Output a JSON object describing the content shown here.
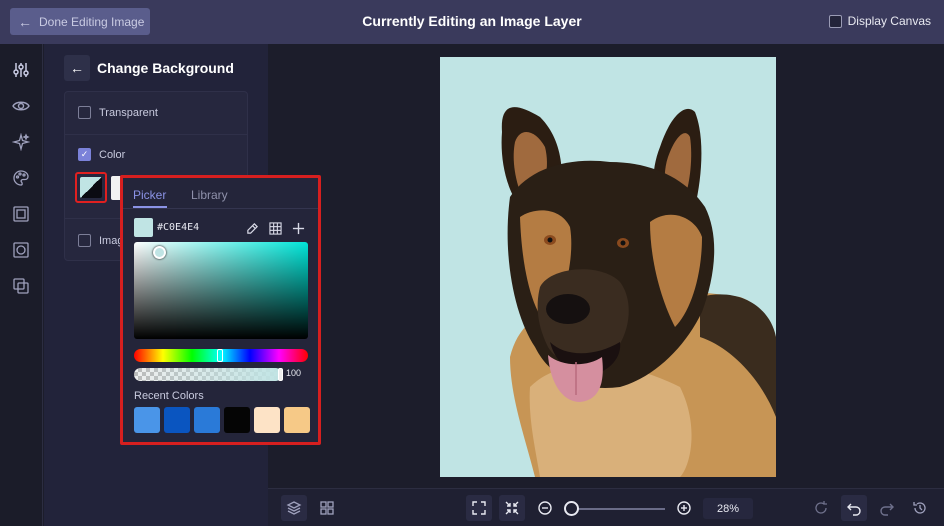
{
  "topbar": {
    "done_label": "Done Editing Image",
    "title": "Currently Editing an Image Layer",
    "display_canvas_label": "Display Canvas",
    "display_canvas_checked": false
  },
  "rail": {
    "icons": [
      "adjust-sliders-icon",
      "eye-icon",
      "sparkles-icon",
      "palette-icon",
      "frame-icon",
      "crop-frame-icon",
      "layers-blend-icon"
    ]
  },
  "panel": {
    "title": "Change Background",
    "options": [
      {
        "label": "Transparent",
        "checked": false
      },
      {
        "label": "Color",
        "checked": true
      },
      {
        "label": "Imag",
        "checked": false
      }
    ],
    "selected_swatch_color": "#C0E4E4"
  },
  "picker": {
    "tabs": [
      "Picker",
      "Library"
    ],
    "active_tab": "Picker",
    "hex_value": "#C0E4E4",
    "alpha_value": "100",
    "recent_label": "Recent Colors",
    "recent_colors": [
      "#4a95e8",
      "#0a55c0",
      "#2a7ad8",
      "#050505",
      "#fde3c6",
      "#f6c987"
    ]
  },
  "canvas": {
    "background_color": "#C0E4E4"
  },
  "bottombar": {
    "zoom_value": "28%"
  }
}
